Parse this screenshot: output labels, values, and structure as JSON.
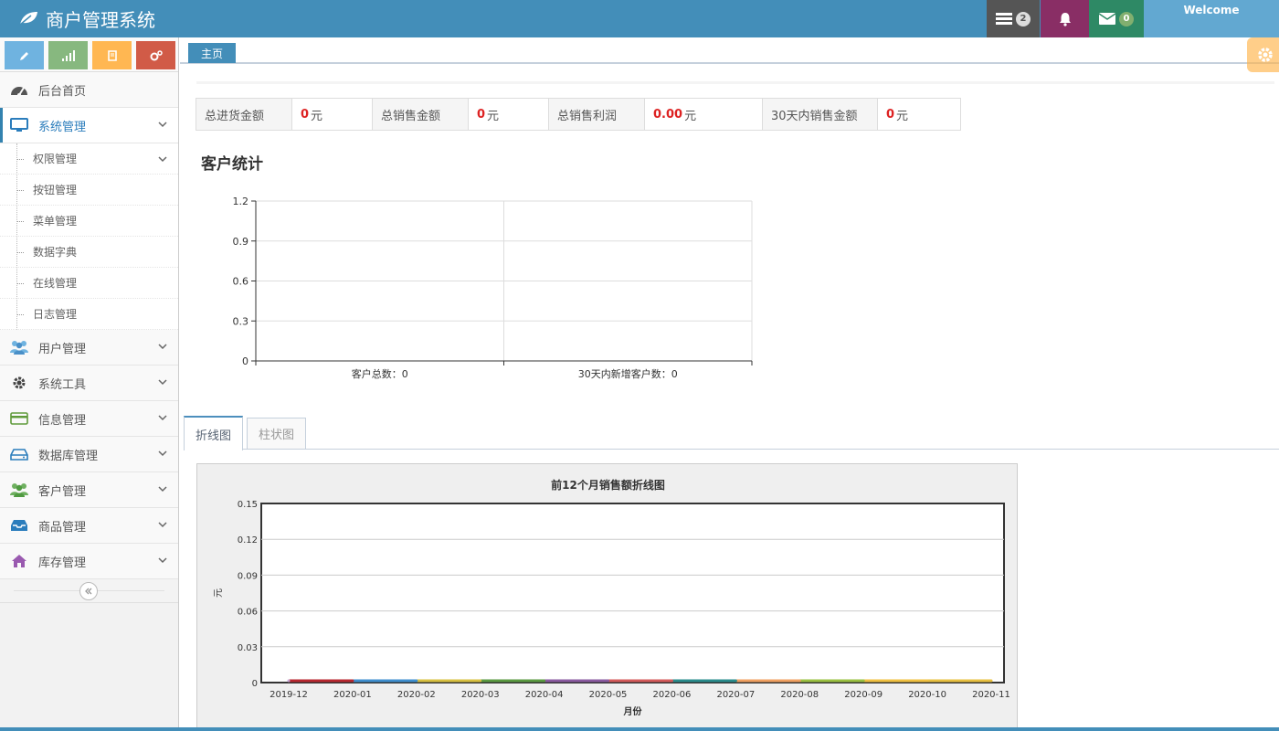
{
  "navbar": {
    "brand": "商户管理系统",
    "tasks_count": "2",
    "messages_count": "0",
    "user_greeting": "Welcome"
  },
  "sidebar": {
    "menu": [
      {
        "label": "后台首页",
        "icon": "dashboard-icon"
      },
      {
        "label": "系统管理",
        "icon": "desktop-icon",
        "active": true,
        "children": [
          "权限管理",
          "按钮管理",
          "菜单管理",
          "数据字典",
          "在线管理",
          "日志管理"
        ]
      },
      {
        "label": "用户管理",
        "icon": "users-icon"
      },
      {
        "label": "系统工具",
        "icon": "cog-icon"
      },
      {
        "label": "信息管理",
        "icon": "credit-card-icon"
      },
      {
        "label": "数据库管理",
        "icon": "hdd-icon"
      },
      {
        "label": "客户管理",
        "icon": "group-icon"
      },
      {
        "label": "商品管理",
        "icon": "inbox-icon"
      },
      {
        "label": "库存管理",
        "icon": "home-icon"
      }
    ]
  },
  "tabs": {
    "home": "主页"
  },
  "stats": [
    {
      "label": "总进货金额",
      "value": "0",
      "unit": "元"
    },
    {
      "label": "总销售金额",
      "value": "0",
      "unit": "元"
    },
    {
      "label": "总销售利润",
      "value": "0.00",
      "unit": "元"
    },
    {
      "label": "30天内销售金额",
      "value": "0",
      "unit": "元"
    }
  ],
  "customer_section": {
    "title": "客户统计"
  },
  "chart_tabs": {
    "line": "折线图",
    "bar": "柱状图"
  },
  "colors": {
    "navbar": "#438eb9",
    "accent_red": "#dd2222"
  },
  "chart_data": [
    {
      "type": "bar",
      "categories": [
        "客户总数：0",
        "30天内新增客户数：0"
      ],
      "values": [
        0,
        0
      ],
      "ylim": [
        0,
        1.2
      ],
      "yticks": [
        "0",
        "0.3",
        "0.6",
        "0.9",
        "1.2"
      ],
      "title": "",
      "xlabel": "",
      "ylabel": "",
      "grid": true
    },
    {
      "type": "line",
      "title": "前12个月销售额折线图",
      "xlabel": "月份",
      "ylabel": "元",
      "categories": [
        "2019-12",
        "2020-01",
        "2020-02",
        "2020-03",
        "2020-04",
        "2020-05",
        "2020-06",
        "2020-07",
        "2020-08",
        "2020-09",
        "2020-10",
        "2020-11"
      ],
      "values": [
        0,
        0,
        0,
        0,
        0,
        0,
        0,
        0,
        0,
        0,
        0,
        0
      ],
      "ylim": [
        0,
        0.15
      ],
      "yticks": [
        "0",
        "0.03",
        "0.06",
        "0.09",
        "0.12",
        "0.15"
      ],
      "segment_colors": [
        "#c9a7d6",
        "#b8272f",
        "#3f8fcf",
        "#d8c040",
        "#5a9a40",
        "#8a5aa0",
        "#d45a5a",
        "#2a8c8c",
        "#f0a060",
        "#9ac040",
        "#f0c040",
        "#e8c040"
      ],
      "grid": true
    }
  ]
}
